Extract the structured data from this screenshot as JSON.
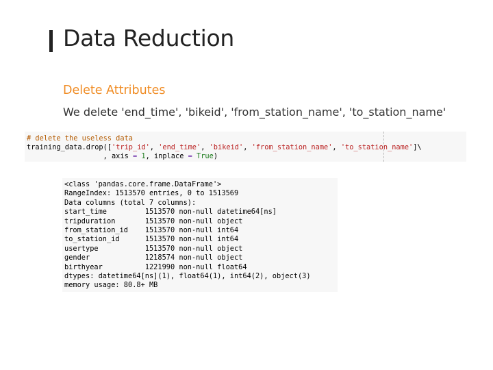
{
  "slide": {
    "title": "Data Reduction",
    "subheading": "Delete Attributes",
    "body": "We delete 'end_time', 'bikeid', 'from_station_name', 'to_station_name'"
  },
  "code": {
    "comment": "# delete the useless data",
    "line1_prefix": "training_data.drop([",
    "arg1": "'trip_id'",
    "sep1": ", ",
    "arg2": "'end_time'",
    "sep2": ", ",
    "arg3": "'bikeid'",
    "sep3": ", ",
    "arg4": "'from_station_name'",
    "sep4": ", ",
    "arg5": "'to_station_name'",
    "line1_suffix": "]\\",
    "line2_indent": "                  , axis ",
    "eq1": "=",
    "line2_mid1": " ",
    "axis_value": "1",
    "line2_mid2": ", inplace ",
    "eq2": "=",
    "line2_mid3": " ",
    "inplace_value": "True",
    "line2_end": ")"
  },
  "output": {
    "lines": [
      "<class 'pandas.core.frame.DataFrame'>",
      "RangeIndex: 1513570 entries, 0 to 1513569",
      "Data columns (total 7 columns):",
      "start_time         1513570 non-null datetime64[ns]",
      "tripduration       1513570 non-null object",
      "from_station_id    1513570 non-null int64",
      "to_station_id      1513570 non-null int64",
      "usertype           1513570 non-null object",
      "gender             1218574 non-null object",
      "birthyear          1221990 non-null float64",
      "dtypes: datetime64[ns](1), float64(1), int64(2), object(3)",
      "memory usage: 80.8+ MB"
    ]
  },
  "colors": {
    "title": "#222222",
    "accent": "#f08c24",
    "code_background": "#f7f7f7",
    "string": "#ba2121",
    "comment": "#b35a00",
    "keyword": "#1a7a1a"
  }
}
